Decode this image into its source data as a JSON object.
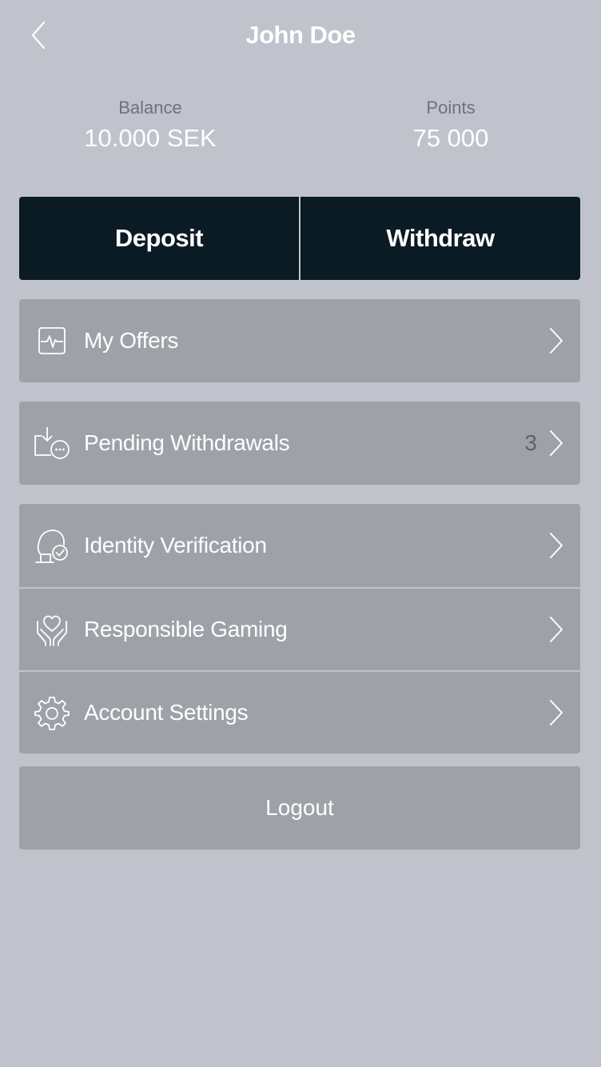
{
  "header": {
    "title": "John Doe",
    "back_icon": "chevron-left-icon"
  },
  "stats": {
    "balance": {
      "label": "Balance",
      "value": "10.000 SEK"
    },
    "points": {
      "label": "Points",
      "value": "75 000"
    }
  },
  "actions": {
    "deposit_label": "Deposit",
    "withdraw_label": "Withdraw"
  },
  "menu": {
    "my_offers": {
      "label": "My Offers",
      "icon": "offers-pulse-icon"
    },
    "pending_withdrawals": {
      "label": "Pending Withdrawals",
      "count": "3",
      "icon": "pending-download-icon"
    },
    "identity_verification": {
      "label": "Identity Verification",
      "icon": "identity-check-icon"
    },
    "responsible_gaming": {
      "label": "Responsible Gaming",
      "icon": "heart-hands-icon"
    },
    "account_settings": {
      "label": "Account Settings",
      "icon": "gear-icon"
    }
  },
  "logout_label": "Logout",
  "colors": {
    "background": "#c0c3cb",
    "card": "#9fa1a9",
    "action_bar": "#0b1b24",
    "label_muted": "#6c7280",
    "text": "#ffffff"
  }
}
